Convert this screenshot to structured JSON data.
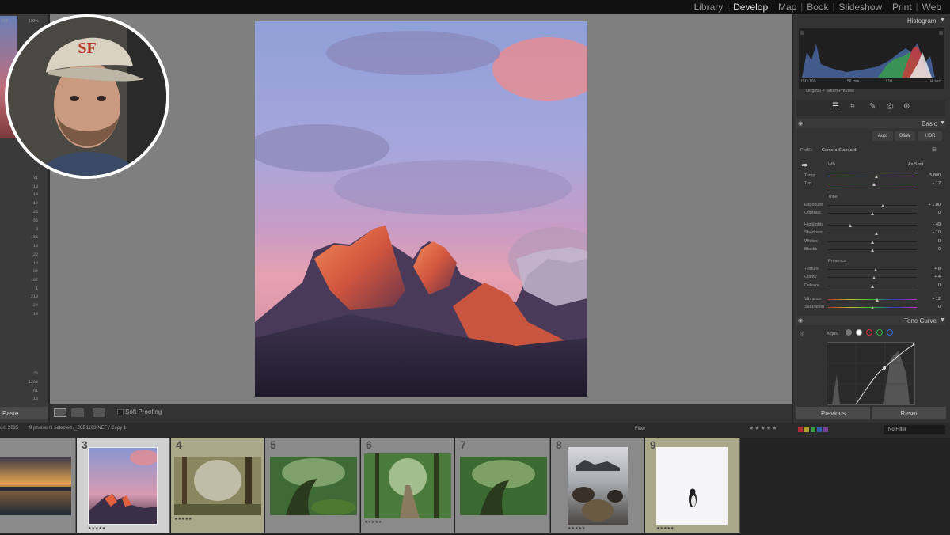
{
  "modules": {
    "items": [
      {
        "label": "Library",
        "active": false
      },
      {
        "label": "Develop",
        "active": true
      },
      {
        "label": "Map",
        "active": false
      },
      {
        "label": "Book",
        "active": false
      },
      {
        "label": "Slideshow",
        "active": false
      },
      {
        "label": "Print",
        "active": false
      },
      {
        "label": "Web",
        "active": false
      }
    ],
    "separator": "|"
  },
  "left_panel": {
    "header_fragment": "Fi 1",
    "header_pct": "100%",
    "values": [
      "31",
      "10",
      "14",
      "19",
      "25",
      "56",
      "3",
      "155",
      "10",
      "22",
      "13",
      "84",
      "107",
      "1",
      "210",
      "24",
      "10",
      "25",
      "1269",
      "61",
      "18"
    ],
    "paste_label": "Paste"
  },
  "toolbar": {
    "soft_proofing_label": "Soft Proofing"
  },
  "histogram": {
    "title": "Histogram",
    "iso": "ISO 100",
    "focal": "56 mm",
    "aperture": "f / 10",
    "shutter": "1/4 sec",
    "preview_label": "Original + Smart Preview"
  },
  "basic": {
    "title": "Basic",
    "buttons": [
      "Auto",
      "B&W",
      "HDR"
    ],
    "profile_label": "Profile",
    "profile_value": "Camera Standard",
    "wb_label": "WB",
    "wb_value": "As Shot",
    "tone_label": "Tone",
    "presence_label": "Presence",
    "sliders": [
      {
        "label": "Temp",
        "value": "5,800",
        "pos": 0.55
      },
      {
        "label": "Tint",
        "value": "+ 12",
        "pos": 0.52
      },
      {
        "label": "Exposure",
        "value": "+ 1.00",
        "pos": 0.62
      },
      {
        "label": "Contrast",
        "value": "0",
        "pos": 0.5
      },
      {
        "label": "Highlights",
        "value": "- 49",
        "pos": 0.25
      },
      {
        "label": "Shadows",
        "value": "+ 10",
        "pos": 0.55
      },
      {
        "label": "Whites",
        "value": "0",
        "pos": 0.5
      },
      {
        "label": "Blacks",
        "value": "0",
        "pos": 0.5
      },
      {
        "label": "Texture",
        "value": "+ 8",
        "pos": 0.54
      },
      {
        "label": "Clarity",
        "value": "+ 4",
        "pos": 0.52
      },
      {
        "label": "Dehaze",
        "value": "0",
        "pos": 0.5
      },
      {
        "label": "Vibrance",
        "value": "+ 12",
        "pos": 0.56
      },
      {
        "label": "Saturation",
        "value": "0",
        "pos": 0.5
      }
    ]
  },
  "tone_curve": {
    "title": "Tone Curve",
    "adjust_label": "Adjust"
  },
  "bottom_buttons": {
    "previous": "Previous",
    "reset": "Reset"
  },
  "filmstrip_bar": {
    "source": "om 2025",
    "info": "9 photos /1 selected /_Z8D1163.NEF / Copy 1",
    "filter_label": "Filter",
    "filter_value": "No Filter"
  },
  "filmstrip": [
    {
      "num": "",
      "stars": "",
      "selected": false
    },
    {
      "num": "3",
      "stars": "★★★★★",
      "selected": true
    },
    {
      "num": "4",
      "stars": "★★★★★",
      "selected": false
    },
    {
      "num": "5",
      "stars": "",
      "selected": false
    },
    {
      "num": "6",
      "stars": "★★★★★",
      "selected": false
    },
    {
      "num": "7",
      "stars": "",
      "selected": false
    },
    {
      "num": "8",
      "stars": "★★★★★",
      "selected": false
    },
    {
      "num": "9",
      "stars": "★★★★★",
      "selected": false
    }
  ],
  "colors": {
    "accent": "#e6e6e6",
    "canvas_bg": "#7f7f7f",
    "panel_bg": "#333333"
  }
}
